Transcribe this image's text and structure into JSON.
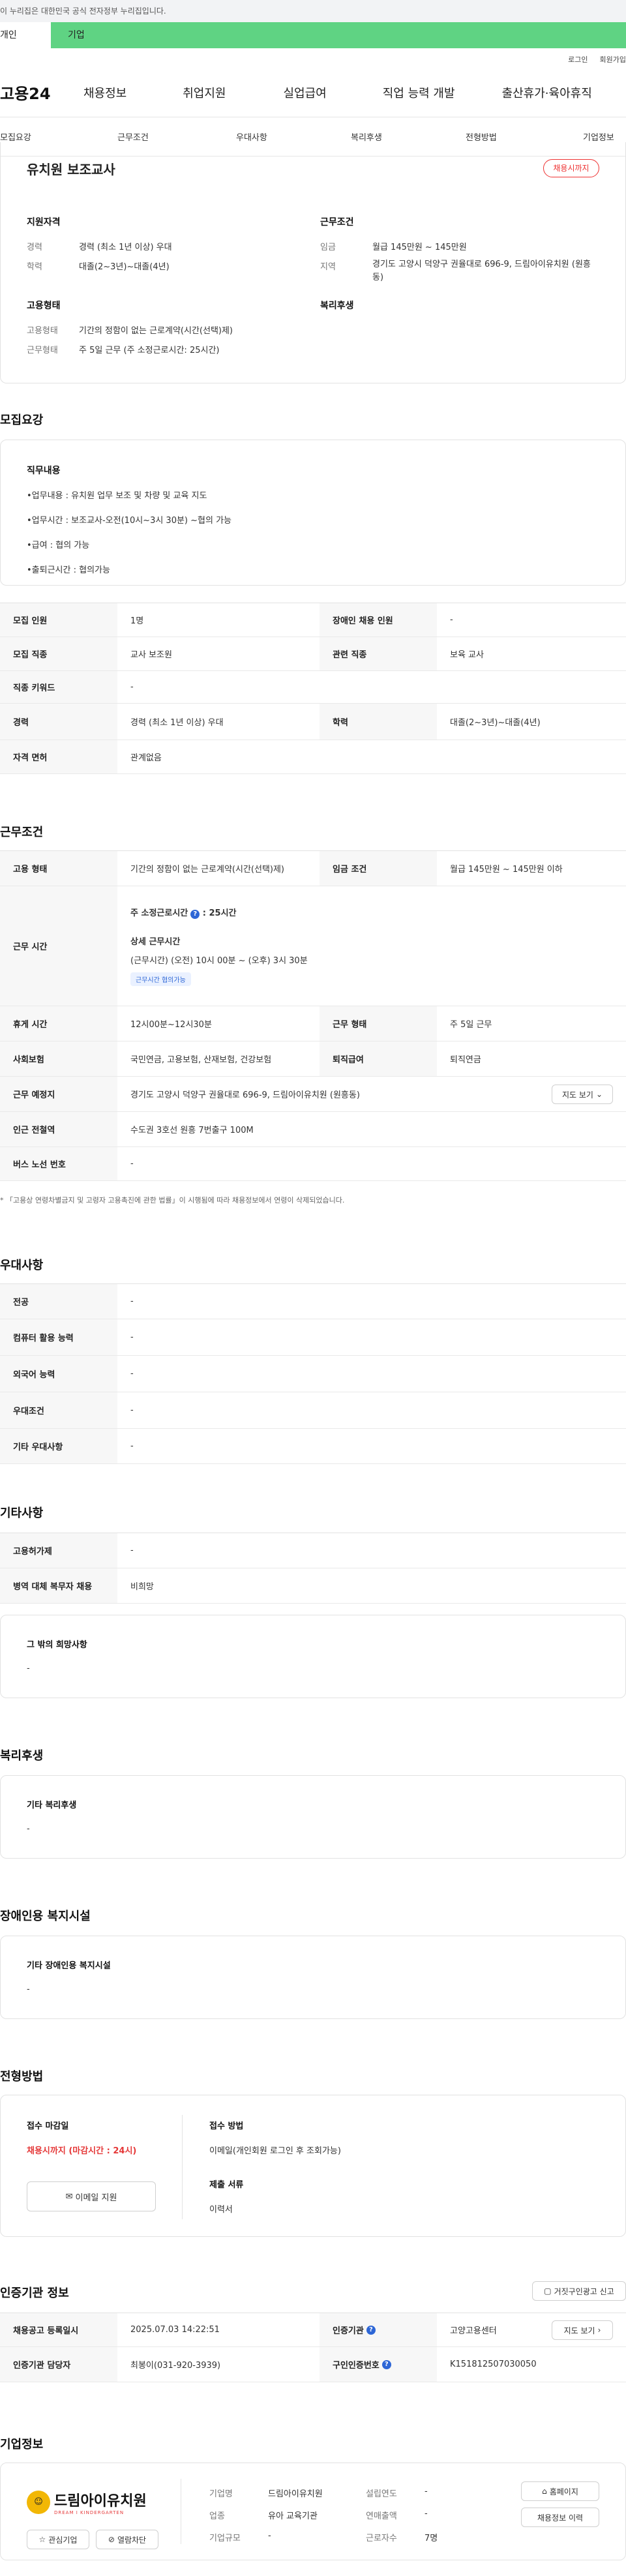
{
  "gov_notice": "이 누리집은 대한민국 공식 전자정부 누리집입니다.",
  "top_tabs": [
    "개인",
    "기업"
  ],
  "util": [
    "로그인",
    "회원가입"
  ],
  "logo": "고용24",
  "gnb": [
    "채용정보",
    "취업지원",
    "실업급여",
    "직업 능력 개발",
    "출산휴가·육아휴직"
  ],
  "snb": [
    "모집요강",
    "근무조건",
    "우대사항",
    "복리후생",
    "전형방법",
    "기업정보"
  ],
  "job_title": "유치원 보조교사",
  "badge": "채용시까지",
  "summary": {
    "qual_title": "지원자격",
    "career_l": "경력",
    "career_v": "경력 (최소 1년 이상) 우대",
    "edu_l": "학력",
    "edu_v": "대졸(2~3년)~대졸(4년)",
    "cond_title": "근무조건",
    "wage_l": "임금",
    "wage_v": "월급 145만원 ~ 145만원",
    "loc_l": "지역",
    "loc_v": "경기도 고양시 덕양구 권율대로 696-9, 드림아이유치원 (원흥동)",
    "emp_title": "고용형태",
    "type_l": "고용형태",
    "type_v": "기간의 정함이 없는 근로계약(시간(선택)제)",
    "wt_l": "근무형태",
    "wt_v": "주 5일 근무 (주 소정근로시간: 25시간)",
    "welfare_title": "복리후생"
  },
  "recruit": {
    "title": "모집요강",
    "duty_title": "직무내용",
    "duties": [
      "•업무내용 : 유치원 업무 보조 및 차량 및 교육 지도",
      "•업무시간 : 보조교사-오전(10시~3시 30분) ~협의 가능",
      "•급여 : 협의 가능",
      "•출퇴근시간 : 협의가능"
    ],
    "rows": [
      [
        "모집 인원",
        "1명",
        "장애인 채용 인원",
        "-"
      ],
      [
        "모집 직종",
        "교사 보조원",
        "관련 직종",
        "보육 교사"
      ],
      [
        "직종 키워드",
        "-"
      ],
      [
        "경력",
        "경력 (최소 1년 이상) 우대",
        "학력",
        "대졸(2~3년)~대졸(4년)"
      ],
      [
        "자격 면허",
        "관계없음"
      ]
    ]
  },
  "work": {
    "title": "근무조건",
    "r1": [
      "고용 형태",
      "기간의 정함이 없는 근로계약(시간(선택)제)",
      "임금 조건",
      "월급 145만원 ~ 145만원 이하"
    ],
    "time_l": "근무 시간",
    "hours": "주 소정근로시간",
    "hours_v": ": 25시간",
    "detail_title": "상세 근무시간",
    "detail_v": "(근무시간) (오전) 10시 00분 ~ (오후) 3시 30분",
    "tag": "근무시간 협의가능",
    "r3": [
      "휴게 시간",
      "12시00분~12시30분",
      "근무 형태",
      "주 5일 근무"
    ],
    "r4": [
      "사회보험",
      "국민연금, 고용보험, 산재보험, 건강보험",
      "퇴직급여",
      "퇴직연금"
    ],
    "r5": [
      "근무 예정지",
      "경기도 고양시 덕양구 권율대로 696-9, 드림아이유치원 (원흥동)"
    ],
    "map_btn": "지도 보기",
    "r6": [
      "인근 전철역",
      "수도권 3호선 원흥 7번출구 100M"
    ],
    "r7": [
      "버스 노선 번호",
      "-"
    ],
    "note": "「고용상 연령차별금지 및 고령자 고용촉진에 관한 법률」이 시행됨에 따라 채용정보에서 연령이 삭제되었습니다."
  },
  "pref": {
    "title": "우대사항",
    "rows": [
      [
        "전공",
        "-"
      ],
      [
        "컴퓨터 활용 능력",
        "-"
      ],
      [
        "외국어 능력",
        "-"
      ],
      [
        "우대조건",
        "-"
      ],
      [
        "기타 우대사항",
        "-"
      ]
    ]
  },
  "etc": {
    "title": "기타사항",
    "rows": [
      [
        "고용허가제",
        "-"
      ],
      [
        "병역 대체 복무자 채용",
        "비희망"
      ]
    ],
    "box_title": "그 밖의 희망사항",
    "box_v": "-"
  },
  "welfare": {
    "title": "복리후생",
    "box_title": "기타 복리후생",
    "box_v": "-"
  },
  "disabled": {
    "title": "장애인용 복지시설",
    "box_title": "기타 장애인용 복지시설",
    "box_v": "-"
  },
  "process": {
    "title": "전형방법",
    "deadline_l": "접수 마감일",
    "deadline_v": "채용시까지 (마감시간 : 24시)",
    "email_btn": "이메일 지원",
    "method_l": "접수 방법",
    "method_v": "이메일(개인회원 로그인 후 조회가능)",
    "docs_l": "제출 서류",
    "docs_v": "이력서"
  },
  "agency": {
    "title": "인증기관 정보",
    "report_btn": "거짓구인광고 신고",
    "rows": [
      [
        "채용공고 등록일시",
        "2025.07.03 14:22:51",
        "인증기관",
        "고양고용센터"
      ],
      [
        "인증기관 담당자",
        "최봉이(031-920-3939)",
        "구인인증번호",
        "K151812507030050"
      ]
    ],
    "map_btn": "지도 보기"
  },
  "company": {
    "title": "기업정보",
    "name": "드림아이유치원",
    "logo_sub": "DREAM I KINDERGARTEN",
    "fav_btn": "관심기업",
    "block_btn": "열람차단",
    "fields": [
      [
        "기업명",
        "드림아이유치원"
      ],
      [
        "업종",
        "유아 교육기관"
      ],
      [
        "기업규모",
        "-"
      ]
    ],
    "fields2": [
      [
        "설립연도",
        "-"
      ],
      [
        "연매출액",
        "-"
      ],
      [
        "근로자수",
        "7명"
      ]
    ],
    "home_btn": "홈페이지",
    "hist_btn": "채용정보 이력"
  },
  "colors": {
    "green": "#5fd383",
    "red": "#e53939",
    "blue": "#2d66d6"
  }
}
